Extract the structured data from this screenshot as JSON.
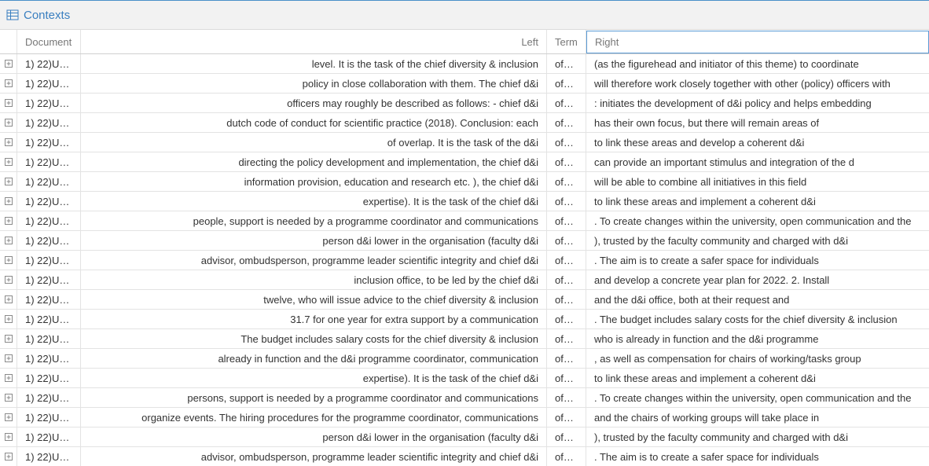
{
  "panel": {
    "title": "Contexts",
    "icon": "table-icon"
  },
  "columns": {
    "document": "Document",
    "left": "Left",
    "term": "Term",
    "right": "Right"
  },
  "rows": [
    {
      "document": "1) 22)U…",
      "left": "level. It is the task of the chief diversity & inclusion",
      "term": "of…",
      "right": "(as the figurehead and initiator of this theme) to coordinate"
    },
    {
      "document": "1) 22)U…",
      "left": "policy in close collaboration with them. The chief d&i",
      "term": "of…",
      "right": "will therefore work closely together with other (policy) officers with"
    },
    {
      "document": "1) 22)U…",
      "left": "officers may roughly be described as follows: - chief d&i",
      "term": "of…",
      "right": ": initiates the development of d&i policy and helps embedding"
    },
    {
      "document": "1) 22)U…",
      "left": "dutch code of conduct for scientific practice (2018). Conclusion: each",
      "term": "of…",
      "right": "has their own focus, but there will remain areas of"
    },
    {
      "document": "1) 22)U…",
      "left": "of overlap. It is the task of the d&i",
      "term": "of…",
      "right": "to link these areas and develop a coherent d&i"
    },
    {
      "document": "1) 22)U…",
      "left": "directing the policy development and implementation, the chief d&i",
      "term": "of…",
      "right": "can provide an important stimulus and integration of the d"
    },
    {
      "document": "1) 22)U…",
      "left": "information provision, education and research etc. ), the chief d&i",
      "term": "of…",
      "right": "will be able to combine all initiatives in this field"
    },
    {
      "document": "1) 22)U…",
      "left": "expertise). It is the task of the chief d&i",
      "term": "of…",
      "right": "to link these areas and implement a coherent d&i"
    },
    {
      "document": "1) 22)U…",
      "left": "people, support is needed by a programme coordinator and communications",
      "term": "of…",
      "right": ". To create changes within the university, open communication and the"
    },
    {
      "document": "1) 22)U…",
      "left": "person d&i lower in the organisation (faculty d&i",
      "term": "of…",
      "right": "), trusted by the faculty community and charged with d&i"
    },
    {
      "document": "1) 22)U…",
      "left": "advisor, ombudsperson, programme leader scientific integrity and chief d&i",
      "term": "of…",
      "right": ". The aim is to create a safer space for individuals"
    },
    {
      "document": "1) 22)U…",
      "left": "inclusion office, to be led by the chief d&i",
      "term": "of…",
      "right": "and develop a concrete year plan for 2022. 2. Install"
    },
    {
      "document": "1) 22)U…",
      "left": "twelve, who will issue advice to the chief diversity & inclusion",
      "term": "of…",
      "right": "and the d&i office, both at their request and"
    },
    {
      "document": "1) 22)U…",
      "left": "31.7 for one year for extra support by a communication",
      "term": "of…",
      "right": ". The budget includes salary costs for the chief diversity & inclusion"
    },
    {
      "document": "1) 22)U…",
      "left": "The budget includes salary costs for the chief diversity & inclusion",
      "term": "of…",
      "right": "who is already in function and the d&i programme"
    },
    {
      "document": "1) 22)U…",
      "left": "already in function and the d&i programme coordinator, communication",
      "term": "of…",
      "right": ", as well as compensation for chairs of working/tasks group"
    },
    {
      "document": "1) 22)U…",
      "left": "expertise). It is the task of the chief d&i",
      "term": "of…",
      "right": "to link these areas and implement a coherent d&i"
    },
    {
      "document": "1) 22)U…",
      "left": "persons, support is needed by a programme coordinator and communications",
      "term": "of…",
      "right": ". To create changes within the university, open communication and the"
    },
    {
      "document": "1) 22)U…",
      "left": "organize events. The hiring procedures for the programme coordinator, communications",
      "term": "of…",
      "right": "and the chairs of working groups will take place in"
    },
    {
      "document": "1) 22)U…",
      "left": "person d&i lower in the organisation (faculty d&i",
      "term": "of…",
      "right": "), trusted by the faculty community and charged with d&i"
    },
    {
      "document": "1) 22)U…",
      "left": "advisor, ombudsperson, programme leader scientific integrity and chief d&i",
      "term": "of…",
      "right": ". The aim is to create a safer space for individuals"
    }
  ]
}
